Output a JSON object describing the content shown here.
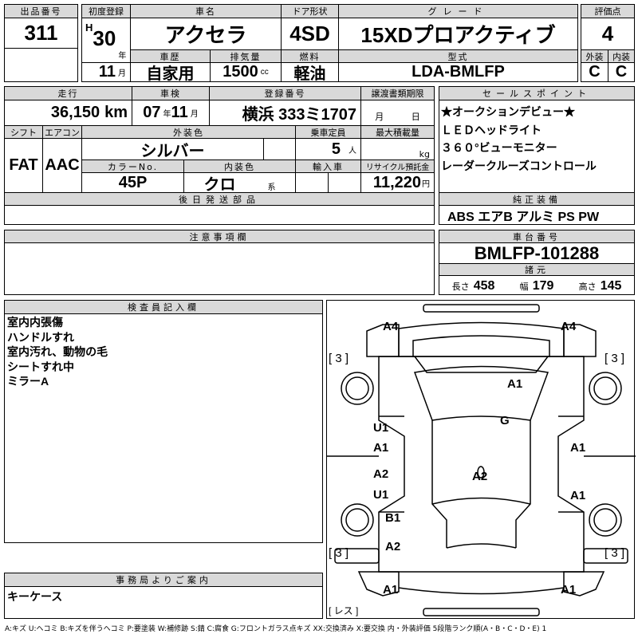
{
  "header": {
    "lot_label": "出品番号",
    "lot": "311",
    "first_reg_label": "初度登録",
    "era": "H",
    "year": "30",
    "year_unit": "年",
    "month": "11",
    "month_unit": "月",
    "name_label": "車名",
    "name": "アクセラ",
    "door_label": "ドア形状",
    "door": "4SD",
    "grade_label": "グレード",
    "grade": "15XDプロアクティブ",
    "score_label": "評価点",
    "score": "4",
    "history_label": "車歴",
    "history": "自家用",
    "disp_label": "排気量",
    "disp": "1500",
    "disp_unit": "cc",
    "fuel_label": "燃料",
    "fuel": "軽油",
    "model_label": "型式",
    "model": "LDA-BMLFP",
    "ext_label": "外装",
    "int_label": "内装",
    "ext": "C",
    "int": "C"
  },
  "details": {
    "mileage_label": "走行",
    "mileage": "36,150",
    "mileage_unit": "km",
    "inspection_label": "車検",
    "insp_year": "07",
    "insp_year_unit": "年",
    "insp_month": "11",
    "insp_month_unit": "月",
    "plate_label": "登録番号",
    "plate": "横浜 333ミ1707",
    "transfer_label": "譲渡書類期限",
    "transfer_month": "月",
    "transfer_day": "日",
    "shift_label": "シフト",
    "shift": "FAT",
    "ac_label": "エアコン",
    "ac": "AAC",
    "color_label": "外装色",
    "color": "シルバー",
    "seats_label": "乗車定員",
    "seats": "5",
    "seats_unit": "人",
    "load_label": "最大積載量",
    "load_unit": "kg",
    "color_no_label": "カラーNo.",
    "color_no": "45P",
    "interior_label": "内装色",
    "interior": "クロ",
    "interior_unit": "系",
    "import_label": "輸入車",
    "recycle_label": "リサイクル預託金",
    "recycle": "11,220",
    "recycle_unit": "円",
    "later_parts_label": "後日発送部品"
  },
  "sales": {
    "label": "セールスポイント",
    "points": [
      "★オークションデビュー★",
      "ＬＥＤヘッドライト",
      "３６０°ビューモニター",
      "レーダークルーズコントロール"
    ],
    "equip_label": "純正装備",
    "equip": "ABS エアB アルミ PS PW"
  },
  "notes": {
    "label": "注意事項欄"
  },
  "chassis": {
    "label": "車台番号",
    "value": "BMLFP-101288",
    "spec_label": "諸元",
    "length_label": "長さ",
    "length": "458",
    "width_label": "幅",
    "width": "179",
    "height_label": "高さ",
    "height": "145"
  },
  "inspector": {
    "label": "検査員記入欄",
    "lines": [
      "室内内張傷",
      "ハンドルすれ",
      "室内汚れ、動物の毛",
      "シートすれ中",
      "ミラーA"
    ]
  },
  "office": {
    "label": "事務局よりご案内",
    "text": "キーケース"
  },
  "diagram": {
    "marks": [
      "A4",
      "A4",
      "[ 3 ]",
      "[ 3 ]",
      "A1",
      "G",
      "U1",
      "A1",
      "A1",
      "A2",
      "U1",
      "A2",
      "A1",
      "B1",
      "A2",
      "[ 3 ]",
      "[ 3 ]",
      "A1",
      "A1",
      "[ レス ]"
    ]
  },
  "legend": "A:キズ U:ヘコミ B:キズを伴うヘコミ P:要塗装 W:補修跡 S:錆 C:腐食 G:フロントガラス点キズ XX:交換済み X:要交換 内・外装評価 5段階ランク順(A・B・C・D・E) 1"
}
